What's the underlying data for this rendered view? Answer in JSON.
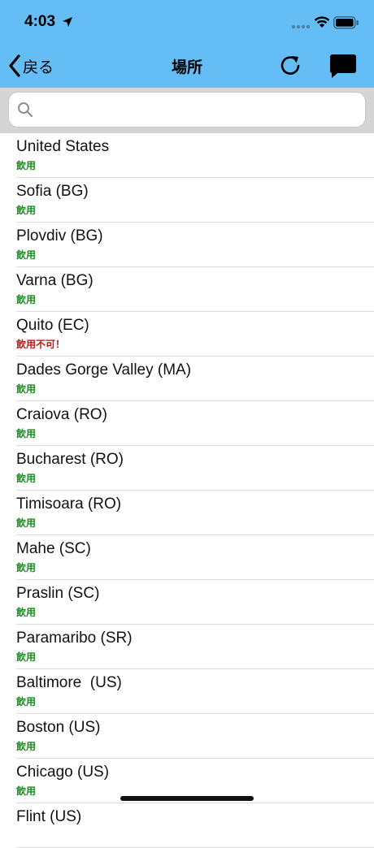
{
  "status_bar": {
    "time": "4:03"
  },
  "nav": {
    "back_label": "戻る",
    "title": "場所"
  },
  "search": {
    "placeholder": ""
  },
  "locations": [
    {
      "name": "United States",
      "status": "飲用",
      "status_color": "#1c8a22"
    },
    {
      "name": "Sofia (BG)",
      "status": "飲用",
      "status_color": "#1c8a22"
    },
    {
      "name": "Plovdiv (BG)",
      "status": "飲用",
      "status_color": "#1c8a22"
    },
    {
      "name": "Varna (BG)",
      "status": "飲用",
      "status_color": "#1c8a22"
    },
    {
      "name": "Quito (EC)",
      "status": "飲用不可！",
      "status_color": "#c01818"
    },
    {
      "name": "Dades Gorge Valley (MA)",
      "status": "飲用",
      "status_color": "#1c8a22"
    },
    {
      "name": "Craiova (RO)",
      "status": "飲用",
      "status_color": "#1c8a22"
    },
    {
      "name": "Bucharest (RO)",
      "status": "飲用",
      "status_color": "#1c8a22"
    },
    {
      "name": "Timisoara (RO)",
      "status": "飲用",
      "status_color": "#1c8a22"
    },
    {
      "name": "Mahe (SC)",
      "status": "飲用",
      "status_color": "#1c8a22"
    },
    {
      "name": "Praslin (SC)",
      "status": "飲用",
      "status_color": "#1c8a22"
    },
    {
      "name": "Paramaribo (SR)",
      "status": "飲用",
      "status_color": "#1c8a22"
    },
    {
      "name": "Baltimore  (US)",
      "status": "飲用",
      "status_color": "#1c8a22"
    },
    {
      "name": "Boston (US)",
      "status": "飲用",
      "status_color": "#1c8a22"
    },
    {
      "name": "Chicago (US)",
      "status": "飲用",
      "status_color": "#1c8a22"
    },
    {
      "name": "Flint (US)",
      "status": "",
      "status_color": "#1c8a22"
    }
  ],
  "colors": {
    "header": "#64bdf4",
    "drinkable": "#1c8a22",
    "not_drinkable": "#c01818"
  },
  "icons": [
    "location-arrow-icon",
    "signal-icon",
    "wifi-icon",
    "battery-icon",
    "chevron-left-icon",
    "refresh-icon",
    "chat-bubble-icon",
    "search-icon"
  ]
}
